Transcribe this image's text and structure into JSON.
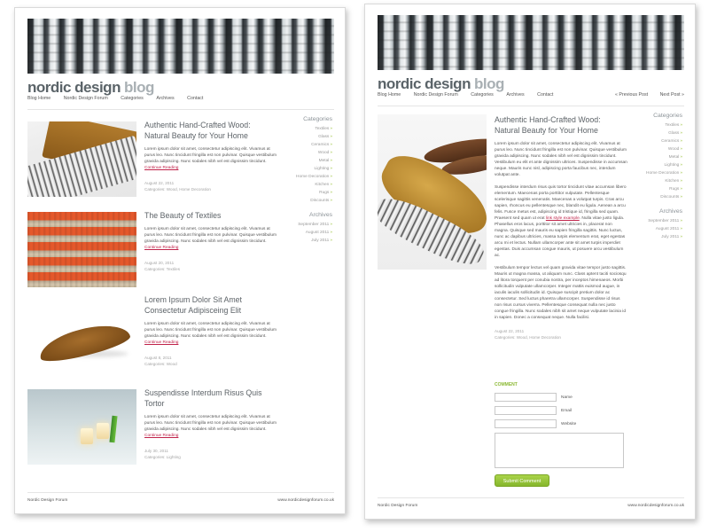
{
  "brand": {
    "name_a": "nordic design",
    "name_b": "blog"
  },
  "nav": {
    "items": [
      "Blog Home",
      "Nordic Design Forum",
      "Categories",
      "Archives",
      "Contact"
    ],
    "prev": "« Previous Post",
    "next": "Next Post »"
  },
  "posts": [
    {
      "title": "Authentic Hand-Crafted Wood: Natural Beauty for Your Home",
      "excerpt": "Lorem ipsum dolor sit amet, consectetur adipiscing elit. Vivamus at purus leo. Nunc tincidunt fringilla est non pulvinar. Quisque vestibulum gravida adipiscing. Nunc sodales nibh vel est dignissim tincidunt.",
      "more": "Continue Reading",
      "date": "August 22, 2011",
      "categories": "Categories: Wood, Home Decoration"
    },
    {
      "title": "The Beauty of Textiles",
      "excerpt": "Lorem ipsum dolor sit amet, consectetur adipiscing elit. Vivamus at purus leo. Nunc tincidunt fringilla est non pulvinar. Quisque vestibulum gravida adipiscing. Nunc sodales nibh vel est dignissim tincidunt.",
      "more": "Continue Reading",
      "date": "August 20, 2011",
      "categories": "Categories: Textiles"
    },
    {
      "title": "Lorem Ipsum Dolor Sit Amet Consectetur Adipisceing Elit",
      "excerpt": "Lorem ipsum dolor sit amet, consectetur adipiscing elit. Vivamus at purus leo. Nunc tincidunt fringilla est non pulvinar. Quisque vestibulum gravida adipiscing. Nunc sodales nibh vel est dignissim tincidunt.",
      "more": "Continue Reading",
      "date": "August 8, 2011",
      "categories": "Categories: Wood"
    },
    {
      "title": "Suspendisse Interdum Risus Quis Tortor",
      "excerpt": "Lorem ipsum dolor sit amet, consectetur adipiscing elit. Vivamus at purus leo. Nunc tincidunt fringilla est non pulvinar. Quisque vestibulum gravida adipiscing. Nunc sodales nibh vel est dignissim tincidunt.",
      "more": "Continue Reading",
      "date": "July 30, 2011",
      "categories": "Categories: Lighting"
    }
  ],
  "sidebar": {
    "categories_title": "Categories",
    "categories": [
      "Textiles",
      "Glass",
      "Ceramics",
      "Wood",
      "Metal",
      "Lighting",
      "Home Decoration",
      "Kitchen",
      "Rugs",
      "Discounts"
    ],
    "archives_title": "Archives",
    "archives": [
      "September 2011",
      "August 2011",
      "July 2011"
    ],
    "arrow": "»"
  },
  "article": {
    "title": "Authentic Hand-Crafted Wood: Natural Beauty for Your Home",
    "para1": "Lorem ipsum dolor sit amet, consectetur adipiscing elit. Vivamus at purus leo. Nunc tincidunt fringilla est non pulvinar. Quisque vestibulum gravida adipiscing. Nunc sodales nibh vel est dignissim tincidunt. Vestibulum eu elit et ante dignissim ultrices. Suspendisse in accumsan neque. Mauris nunc nisl, adipiscing porta faucibus nec, interdum volutpat ante.",
    "para2_a": "Suspendisse interdum risus quis tortor tincidunt vitae accumsan libero elementum. Maecenas porta porttitor vulputate. Pellentesque scelerisque sagittis venenatis. Maecenas a volutpat turpis. Cras arcu sapien, rhoncus eu pellentesque nec, blandit eu ligula. Aenean a arcu felis. Fusce metus est, adipiscing id tristique id, fringilla sed quam. Praesent sed quam ut erat",
    "link": "link style example",
    "para2_b": ". Nulla vitae justo ligula. Phasellus eros lacus, porttitor sit amet ultricies in, placerat non magna. Quisque sed mauris eu sapien fringilla sagittis. Nunc luctus, nunc ac dapibus ultricies, massa turpis elementum erat, eget egestas arcu mi et lectus. Nullam ullamcorper ante sit amet turpis imperdiet egestas. Duis accumsan congue mauris, ut posuere arcu vestibulum ac.",
    "para3": "Vestibulum tempor lectus vel quam gravida vitae tempor justo sagittis. Mauris ut magna massa, ut aliquam nunc. Class aptent taciti sociosqu ad litora torquent per conubia nostra, per inceptos himenaeos. Morbi sollicitudin vulputate ullamcorper. Integer mattis euismod augue, in iaculis iaculis sollicitudin id. Quisque suscipit pretium dolor ac consectetur. Sed luctus pharetra ullamcorper. Suspendisse id risus non risus cursus viverra. Pellentesque consequat nulla nec justo congue fringilla. Nunc sodales nibh sit amet neque vulputate lacinia id in sapien. Donec a consequat neque. Nulla facilisi.",
    "date": "August 22, 2011",
    "categories": "Categories: Wood, Home Decoration"
  },
  "comment": {
    "heading": "COMMENT",
    "name_label": "Name",
    "email_label": "Email",
    "website_label": "Website",
    "submit": "Submit Comment"
  },
  "footer": {
    "left": "Nordic Design Forum",
    "right": "www.nordicdesignforum.co.uk"
  },
  "colors": {
    "accent_green": "#8cb934",
    "link_red": "#c0234a",
    "title_gray": "#5d6368"
  }
}
